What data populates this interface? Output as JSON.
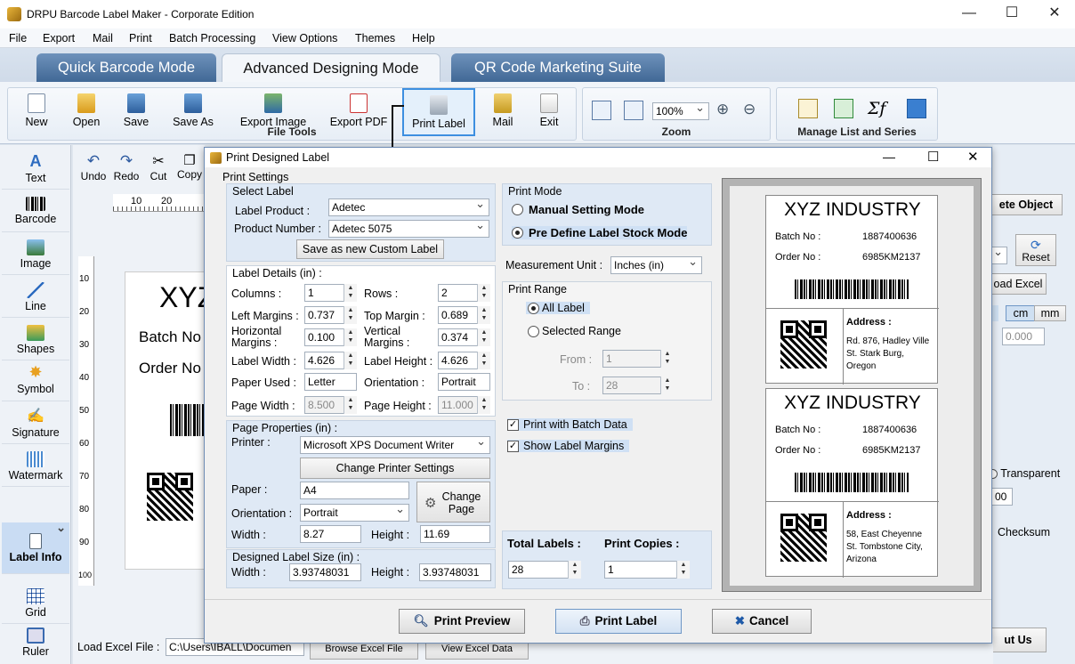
{
  "app": {
    "title": "DRPU Barcode Label Maker - Corporate Edition"
  },
  "menu": [
    "File",
    "Export",
    "Mail",
    "Print",
    "Batch Processing",
    "View Options",
    "Themes",
    "Help"
  ],
  "modes": [
    "Quick Barcode Mode",
    "Advanced Designing Mode",
    "QR Code Marketing Suite"
  ],
  "ribbon": {
    "file_tools": [
      "New",
      "Open",
      "Save",
      "Save As",
      "Export Image",
      "Export PDF",
      "Print Label",
      "Mail",
      "Exit"
    ],
    "file_tools_label": "File Tools",
    "zoom_label": "Zoom",
    "zoom_value": "100%",
    "manage_label": "Manage List and Series"
  },
  "left_tools": [
    "Text",
    "Barcode",
    "Image",
    "Line",
    "Shapes",
    "Symbol",
    "Signature",
    "Watermark",
    "Label Info",
    "Grid",
    "Ruler"
  ],
  "edit_tools": [
    "Undo",
    "Redo",
    "Cut",
    "Copy"
  ],
  "background": {
    "label_text": [
      "XYZ",
      "Batch No",
      "Order No"
    ],
    "ruler_ticks": [
      "10",
      "20"
    ],
    "ruler_v": [
      "10",
      "20",
      "30",
      "40",
      "50",
      "60",
      "70",
      "80",
      "90",
      "100"
    ],
    "delete_object": "ete Object",
    "reset": "Reset",
    "load_excel_btn": "oad Excel",
    "units": [
      "cm",
      "mm"
    ],
    "value": "0.000",
    "transparent": "Transparent",
    "checksum": "Checksum",
    "spin_val": "00",
    "about_us": "ut Us",
    "load_excel_label": "Load Excel File :",
    "excel_path": "C:\\Users\\IBALL\\Documen",
    "browse": "Browse Excel File",
    "view": "View Excel Data"
  },
  "dialog": {
    "title": "Print Designed Label",
    "print_settings": "Print Settings",
    "select_label": "Select Label",
    "label_product_lbl": "Label Product :",
    "label_product": "Adetec",
    "product_number_lbl": "Product Number :",
    "product_number": "Adetec 5075",
    "save_custom": "Save as new Custom Label",
    "label_details": "Label Details (in) :",
    "columns_lbl": "Columns :",
    "columns": "1",
    "rows_lbl": "Rows :",
    "rows": "2",
    "left_margins_lbl": "Left Margins :",
    "left_margins": "0.737",
    "top_margin_lbl": "Top Margin :",
    "top_margin": "0.689",
    "h_margins_lbl": "Horizontal Margins :",
    "h_margins": "0.100",
    "v_margins_lbl": "Vertical Margins :",
    "v_margins": "0.374",
    "label_width_lbl": "Label Width :",
    "label_width": "4.626",
    "label_height_lbl": "Label Height :",
    "label_height": "4.626",
    "paper_used_lbl": "Paper Used :",
    "paper_used": "Letter",
    "orientation_lbl": "Orientation :",
    "orientation": "Portrait",
    "page_width_lbl": "Page Width :",
    "page_width": "8.500",
    "page_height_lbl": "Page Height :",
    "page_height": "11.000",
    "page_props": "Page Properties (in) :",
    "printer_lbl": "Printer :",
    "printer": "Microsoft XPS Document Writer",
    "change_printer": "Change Printer Settings",
    "paper_lbl": "Paper :",
    "paper": "A4",
    "change_page": "Change Page",
    "orientation2_lbl": "Orientation :",
    "orientation2": "Portrait",
    "width_lbl": "Width :",
    "width": "8.27",
    "height_lbl": "Height :",
    "height": "11.69",
    "designed_size": "Designed Label Size (in) :",
    "dwidth_lbl": "Width :",
    "dwidth": "3.93748031",
    "dheight_lbl": "Height :",
    "dheight": "3.93748031",
    "print_mode": "Print Mode",
    "manual_mode": "Manual Setting Mode",
    "predefine_mode": "Pre Define Label Stock Mode",
    "measurement_lbl": "Measurement Unit :",
    "measurement": "Inches (in)",
    "print_range": "Print Range",
    "all_label": "All Label",
    "selected_range": "Selected Range",
    "from_lbl": "From :",
    "from": "1",
    "to_lbl": "To :",
    "to": "28",
    "batch_data": "Print with Batch Data",
    "show_margins": "Show Label Margins",
    "total_labels_lbl": "Total Labels :",
    "total_labels": "28",
    "print_copies_lbl": "Print Copies :",
    "print_copies": "1",
    "print_preview": "Print Preview",
    "print_label": "Print Label",
    "cancel": "Cancel"
  },
  "preview_labels": [
    {
      "heading": "XYZ INDUSTRY",
      "batch_lbl": "Batch No :",
      "batch": "1887400636",
      "order_lbl": "Order No :",
      "order": "6985KM2137",
      "address_lbl": "Address :",
      "address": [
        "Rd. 876, Hadley Ville",
        "St. Stark Burg,",
        "Oregon"
      ]
    },
    {
      "heading": "XYZ INDUSTRY",
      "batch_lbl": "Batch No :",
      "batch": "1887400636",
      "order_lbl": "Order No :",
      "order": "6985KM2137",
      "address_lbl": "Address :",
      "address": [
        "58, East Cheyenne",
        "St. Tombstone City,",
        "Arizona"
      ]
    }
  ]
}
